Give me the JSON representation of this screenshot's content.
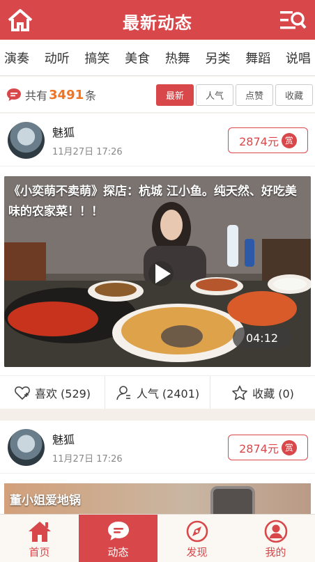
{
  "header": {
    "title": "最新动态",
    "home_icon": "home-icon",
    "menu_icon": "search-list-icon"
  },
  "categories": [
    "演奏",
    "动听",
    "搞笑",
    "美食",
    "热舞",
    "另类",
    "舞蹈",
    "说唱"
  ],
  "filter": {
    "prefix": "共有",
    "count": "3491",
    "suffix": "条",
    "tabs": [
      "最新",
      "人气",
      "点赞",
      "收藏"
    ]
  },
  "posts": [
    {
      "user": "魅狐",
      "time": "11月27日 17:26",
      "reward": "2874元",
      "reward_badge": "赏",
      "caption": "《小奕萌不卖萌》探店：杭城 江小鱼。纯天然、好吃美味的农家菜！！！",
      "duration": "04:12",
      "likes": "喜欢 (529)",
      "popularity": "人气 (2401)",
      "favorites": "收藏 (0)"
    },
    {
      "user": "魅狐",
      "time": "11月27日 17:26",
      "reward": "2874元",
      "reward_badge": "赏",
      "caption": "董小姐爱地锅"
    }
  ],
  "tabbar": [
    "首页",
    "动态",
    "发现",
    "我的"
  ],
  "colors": {
    "brand": "#d8474a",
    "count": "#f07424"
  }
}
